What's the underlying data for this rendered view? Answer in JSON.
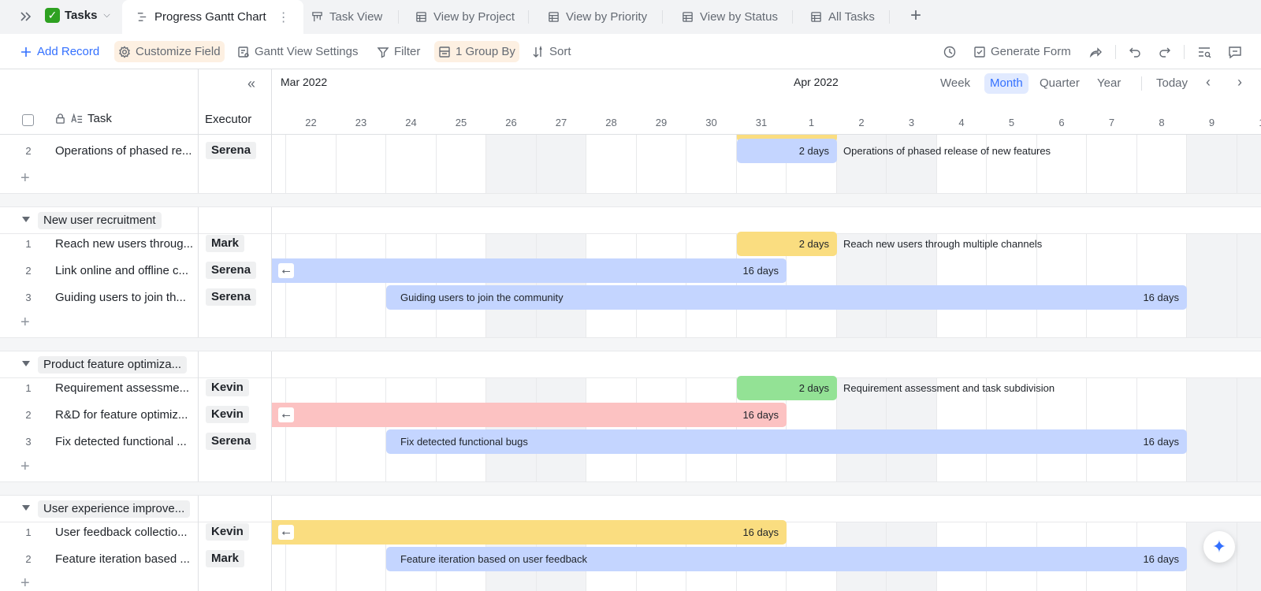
{
  "tabbar": {
    "app_name": "Tasks",
    "tabs": [
      {
        "label": "Progress Gantt Chart",
        "active": true
      },
      {
        "label": "Task View"
      },
      {
        "label": "View by Project"
      },
      {
        "label": "View by Priority"
      },
      {
        "label": "View by Status"
      },
      {
        "label": "All Tasks"
      }
    ]
  },
  "toolbar": {
    "add_record": "Add Record",
    "customize_field": "Customize Field",
    "gantt_settings": "Gantt View Settings",
    "filter": "Filter",
    "group_by": "1 Group By",
    "sort": "Sort",
    "generate_form": "Generate Form"
  },
  "columns": {
    "task": "Task",
    "executor": "Executor"
  },
  "timeline": {
    "month_left": "Mar 2022",
    "month_right": "Apr 2022",
    "ranges": [
      "Week",
      "Month",
      "Quarter",
      "Year"
    ],
    "active_range": "Month",
    "today": "Today",
    "days": [
      "22",
      "23",
      "24",
      "25",
      "26",
      "27",
      "28",
      "29",
      "30",
      "31",
      "1",
      "2",
      "3",
      "4",
      "5",
      "6",
      "7",
      "8",
      "9",
      "1"
    ]
  },
  "top_row": {
    "index": "2",
    "title": "Operations of phased re...",
    "executor": "Serena",
    "bar_duration": "2 days",
    "bar_label": "Operations of phased release of new features"
  },
  "groups": [
    {
      "name": "New user recruitment",
      "rows": [
        {
          "index": "1",
          "title": "Reach new users throug...",
          "executor": "Mark",
          "duration": "2 days",
          "label": "Reach new users through multiple channels"
        },
        {
          "index": "2",
          "title": "Link online and offline c...",
          "executor": "Serena",
          "duration": "16 days",
          "label": ""
        },
        {
          "index": "3",
          "title": "Guiding users to join th...",
          "executor": "Serena",
          "duration": "16 days",
          "label": "Guiding users to join the community"
        }
      ]
    },
    {
      "name": "Product feature optimiza...",
      "rows": [
        {
          "index": "1",
          "title": "Requirement assessme...",
          "executor": "Kevin",
          "duration": "2 days",
          "label": "Requirement assessment and task subdivision"
        },
        {
          "index": "2",
          "title": "R&D for feature optimiz...",
          "executor": "Kevin",
          "duration": "16 days",
          "label": ""
        },
        {
          "index": "3",
          "title": "Fix detected functional ...",
          "executor": "Serena",
          "duration": "16 days",
          "label": "Fix detected functional bugs"
        }
      ]
    },
    {
      "name": "User experience improve...",
      "rows": [
        {
          "index": "1",
          "title": "User feedback collectio...",
          "executor": "Kevin",
          "duration": "16 days",
          "label": ""
        },
        {
          "index": "2",
          "title": "Feature iteration based ...",
          "executor": "Mark",
          "duration": "16 days",
          "label": "Feature iteration based on user feedback"
        }
      ]
    }
  ],
  "colors": {
    "blue": "#c4d5ff",
    "yellow": "#fadd80",
    "green": "#93e295",
    "red": "#fcc2c2",
    "accent": "#3370ff"
  }
}
